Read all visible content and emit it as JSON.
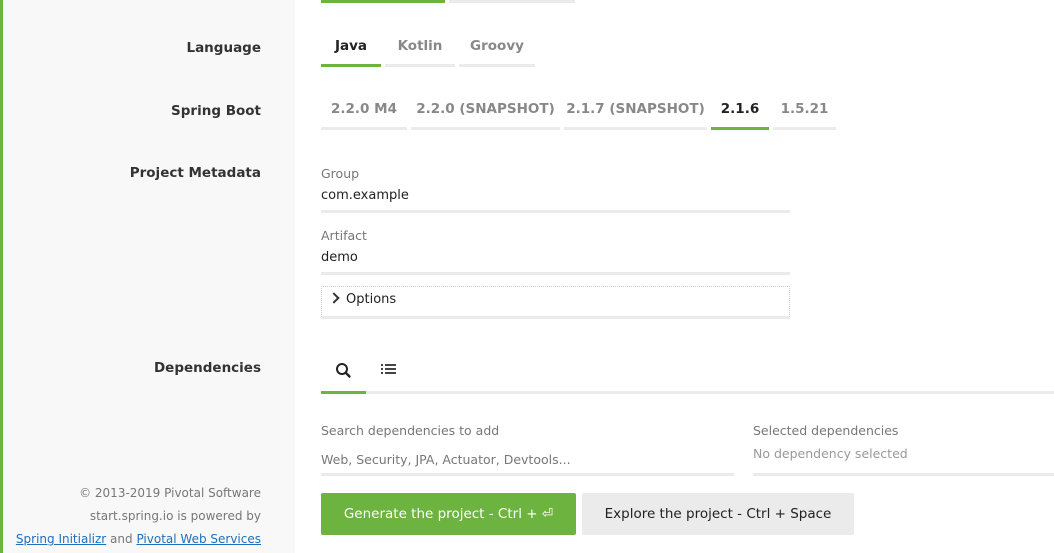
{
  "sections": {
    "language": "Language",
    "spring_boot": "Spring Boot",
    "project_metadata": "Project Metadata",
    "dependencies": "Dependencies"
  },
  "language": {
    "options": [
      "Java",
      "Kotlin",
      "Groovy"
    ],
    "selected": "Java"
  },
  "spring_boot": {
    "options": [
      "2.2.0 M4",
      "2.2.0 (SNAPSHOT)",
      "2.1.7 (SNAPSHOT)",
      "2.1.6",
      "1.5.21"
    ],
    "selected": "2.1.6"
  },
  "metadata": {
    "group_label": "Group",
    "group_value": "com.example",
    "artifact_label": "Artifact",
    "artifact_value": "demo",
    "options_label": "Options"
  },
  "dependencies": {
    "tabs": [
      {
        "name": "search",
        "icon": "search-icon",
        "active": true
      },
      {
        "name": "list",
        "icon": "list-icon",
        "active": false
      }
    ],
    "search_label": "Search dependencies to add",
    "search_placeholder": "Web, Security, JPA, Actuator, Devtools...",
    "selected_label": "Selected dependencies",
    "selected_empty": "No dependency selected"
  },
  "actions": {
    "generate_label": "Generate the project - Ctrl + ⏎",
    "explore_label": "Explore the project - Ctrl + Space"
  },
  "footer": {
    "copyright": "© 2013-2019 Pivotal Software",
    "powered_prefix": "start.spring.io is powered by",
    "link1": "Spring Initializr",
    "and": "and",
    "link2": "Pivotal Web Services"
  },
  "colors": {
    "accent": "#6db33f",
    "inactive_tab": "#ebebeb",
    "sidebar_bg": "#f8f8f8"
  }
}
